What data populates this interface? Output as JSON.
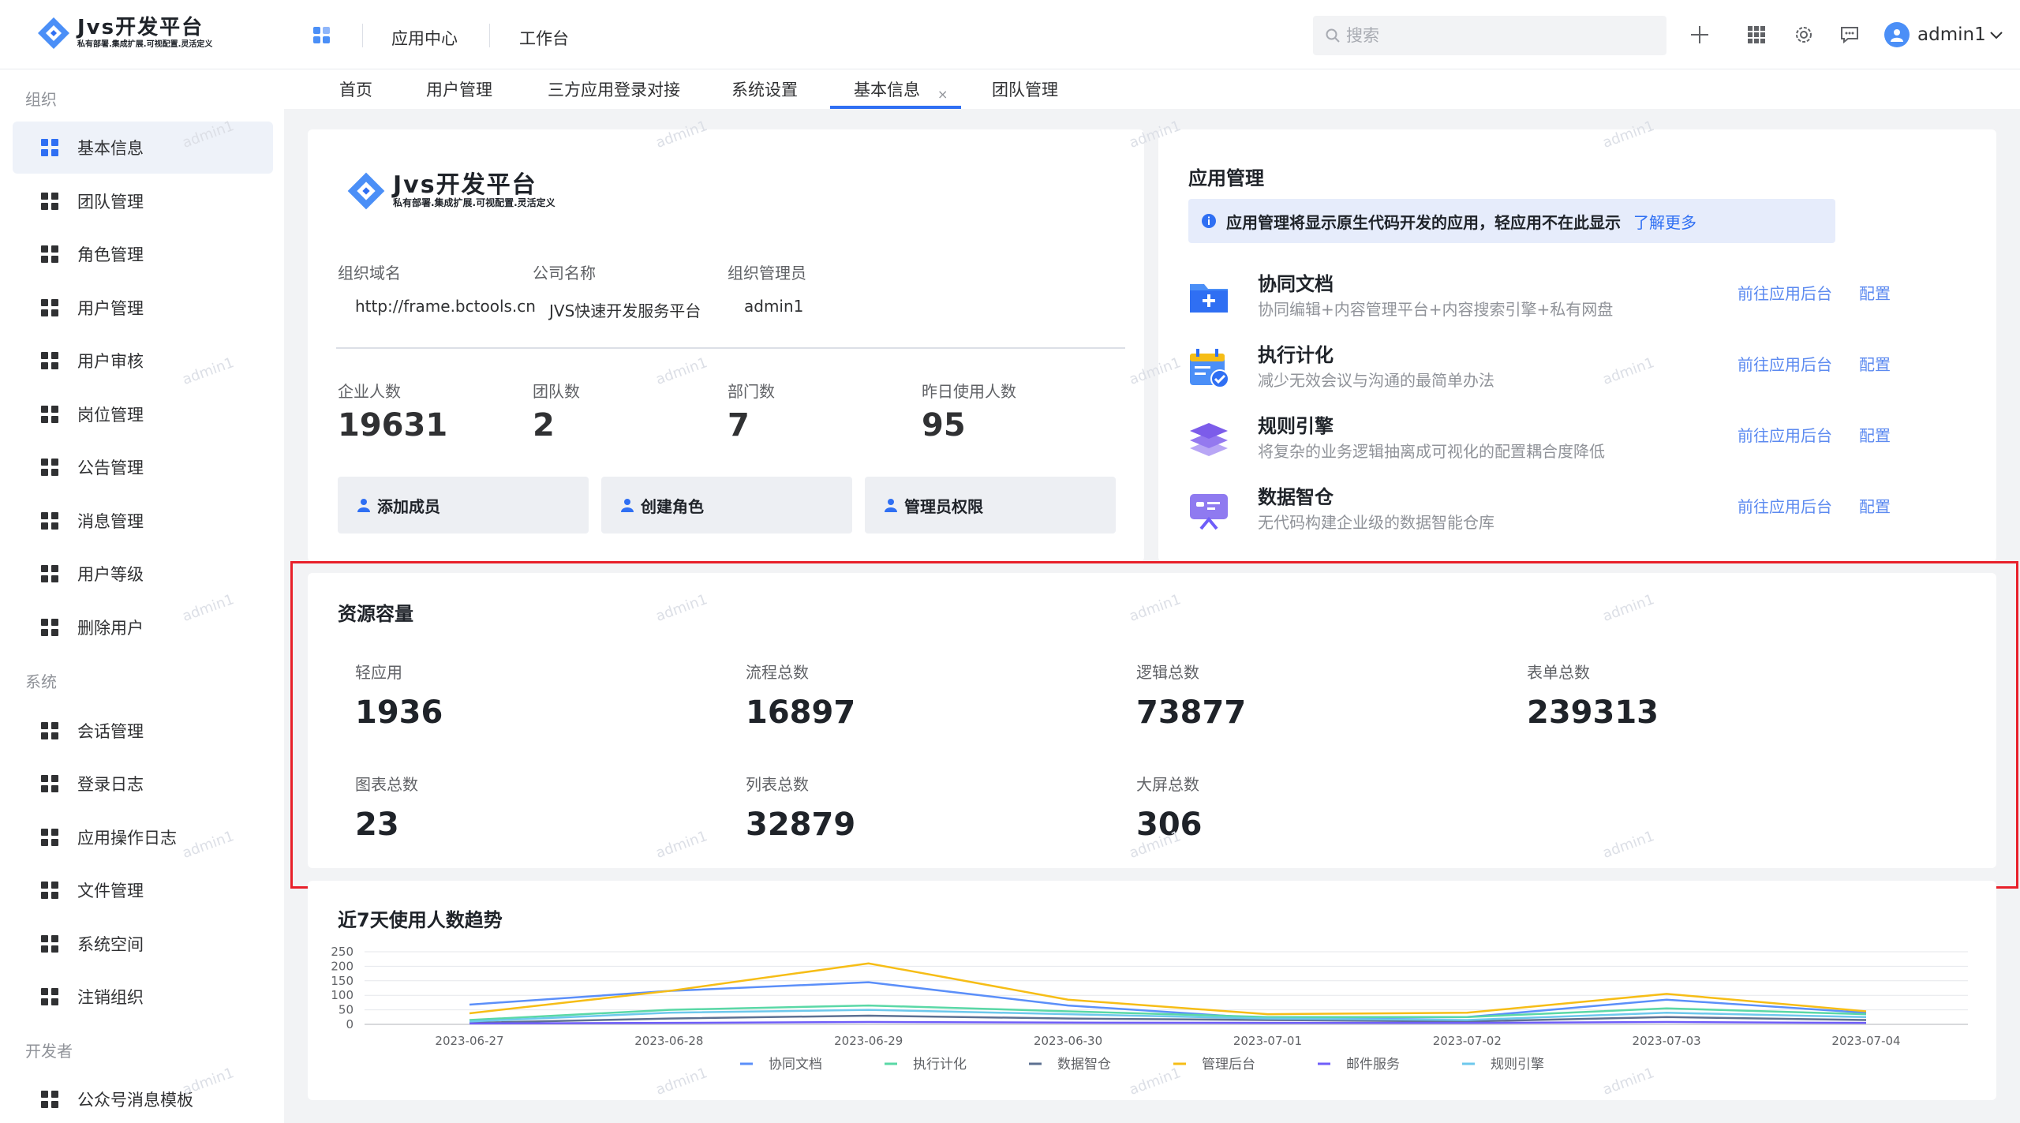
{
  "brand": {
    "title": "Jvs开发平台",
    "subtitle": "私有部署.集成扩展.可视配置.灵活定义"
  },
  "topnav": {
    "items": [
      "应用中心",
      "工作台"
    ]
  },
  "search": {
    "placeholder": "搜索"
  },
  "user": {
    "name": "admin1"
  },
  "sidebar": {
    "groups": [
      {
        "label": "组织",
        "items": [
          "基本信息",
          "团队管理",
          "角色管理",
          "用户管理",
          "用户审核",
          "岗位管理",
          "公告管理",
          "消息管理",
          "用户等级",
          "删除用户"
        ]
      },
      {
        "label": "系统",
        "items": [
          "会话管理",
          "登录日志",
          "应用操作日志",
          "文件管理",
          "系统空间",
          "注销组织"
        ]
      },
      {
        "label": "开发者",
        "items": [
          "公众号消息模板"
        ]
      }
    ],
    "active": "基本信息"
  },
  "tabs": [
    "首页",
    "用户管理",
    "三方应用登录对接",
    "系统设置",
    "基本信息",
    "团队管理"
  ],
  "tab_close": "×",
  "org": {
    "fields": [
      {
        "label": "组织域名",
        "value": "http://frame.bctools.cn"
      },
      {
        "label": "公司名称",
        "value": "JVS快速开发服务平台"
      },
      {
        "label": "组织管理员",
        "value": "admin1"
      }
    ],
    "stats": [
      {
        "label": "企业人数",
        "value": "19631"
      },
      {
        "label": "团队数",
        "value": "2"
      },
      {
        "label": "部门数",
        "value": "7"
      },
      {
        "label": "昨日使用人数",
        "value": "95"
      }
    ],
    "actions": [
      "添加成员",
      "创建角色",
      "管理员权限"
    ]
  },
  "apps": {
    "title": "应用管理",
    "notice": "应用管理将显示原生代码开发的应用，轻应用不在此显示",
    "notice_link": "了解更多",
    "goto_label": "前往应用后台",
    "config_label": "配置",
    "items": [
      {
        "name": "协同文档",
        "desc": "协同编辑+内容管理平台+内容搜索引擎+私有网盘",
        "icon": "folder-plus-icon"
      },
      {
        "name": "执行计化",
        "desc": "减少无效会议与沟通的最简单办法",
        "icon": "calendar-check-icon"
      },
      {
        "name": "规则引擎",
        "desc": "将复杂的业务逻辑抽离成可视化的配置耦合度降低",
        "icon": "layers-icon"
      },
      {
        "name": "数据智仓",
        "desc": "无代码构建企业级的数据智能仓库",
        "icon": "data-board-icon"
      }
    ]
  },
  "resources": {
    "title": "资源容量",
    "items": [
      {
        "label": "轻应用",
        "value": "1936"
      },
      {
        "label": "流程总数",
        "value": "16897"
      },
      {
        "label": "逻辑总数",
        "value": "73877"
      },
      {
        "label": "表单总数",
        "value": "239313"
      },
      {
        "label": "图表总数",
        "value": "23"
      },
      {
        "label": "列表总数",
        "value": "32879"
      },
      {
        "label": "大屏总数",
        "value": "306"
      }
    ]
  },
  "watermark": "admin1",
  "chart_data": {
    "type": "line",
    "title": "近7天使用人数趋势",
    "x": [
      "2023-06-27",
      "2023-06-28",
      "2023-06-29",
      "2023-06-30",
      "2023-07-01",
      "2023-07-02",
      "2023-07-03",
      "2023-07-04"
    ],
    "ylim": [
      0,
      250
    ],
    "yticks": [
      0,
      50,
      100,
      150,
      200,
      250
    ],
    "grid": true,
    "legend_position": "bottom",
    "series": [
      {
        "name": "协同文档",
        "color": "#5b8ff9",
        "values": [
          68,
          115,
          145,
          65,
          20,
          25,
          85,
          40
        ]
      },
      {
        "name": "执行计化",
        "color": "#5ad8a6",
        "values": [
          15,
          50,
          65,
          45,
          25,
          25,
          55,
          35
        ]
      },
      {
        "name": "数据智仓",
        "color": "#5d7092",
        "values": [
          5,
          20,
          30,
          20,
          15,
          10,
          25,
          15
        ]
      },
      {
        "name": "管理后台",
        "color": "#f6bd16",
        "values": [
          38,
          115,
          210,
          85,
          35,
          40,
          105,
          45
        ]
      },
      {
        "name": "邮件服务",
        "color": "#6f5ef9",
        "values": [
          3,
          5,
          8,
          6,
          5,
          5,
          8,
          5
        ]
      },
      {
        "name": "规则引擎",
        "color": "#6dc8ec",
        "values": [
          10,
          40,
          50,
          35,
          20,
          15,
          40,
          25
        ]
      }
    ]
  }
}
